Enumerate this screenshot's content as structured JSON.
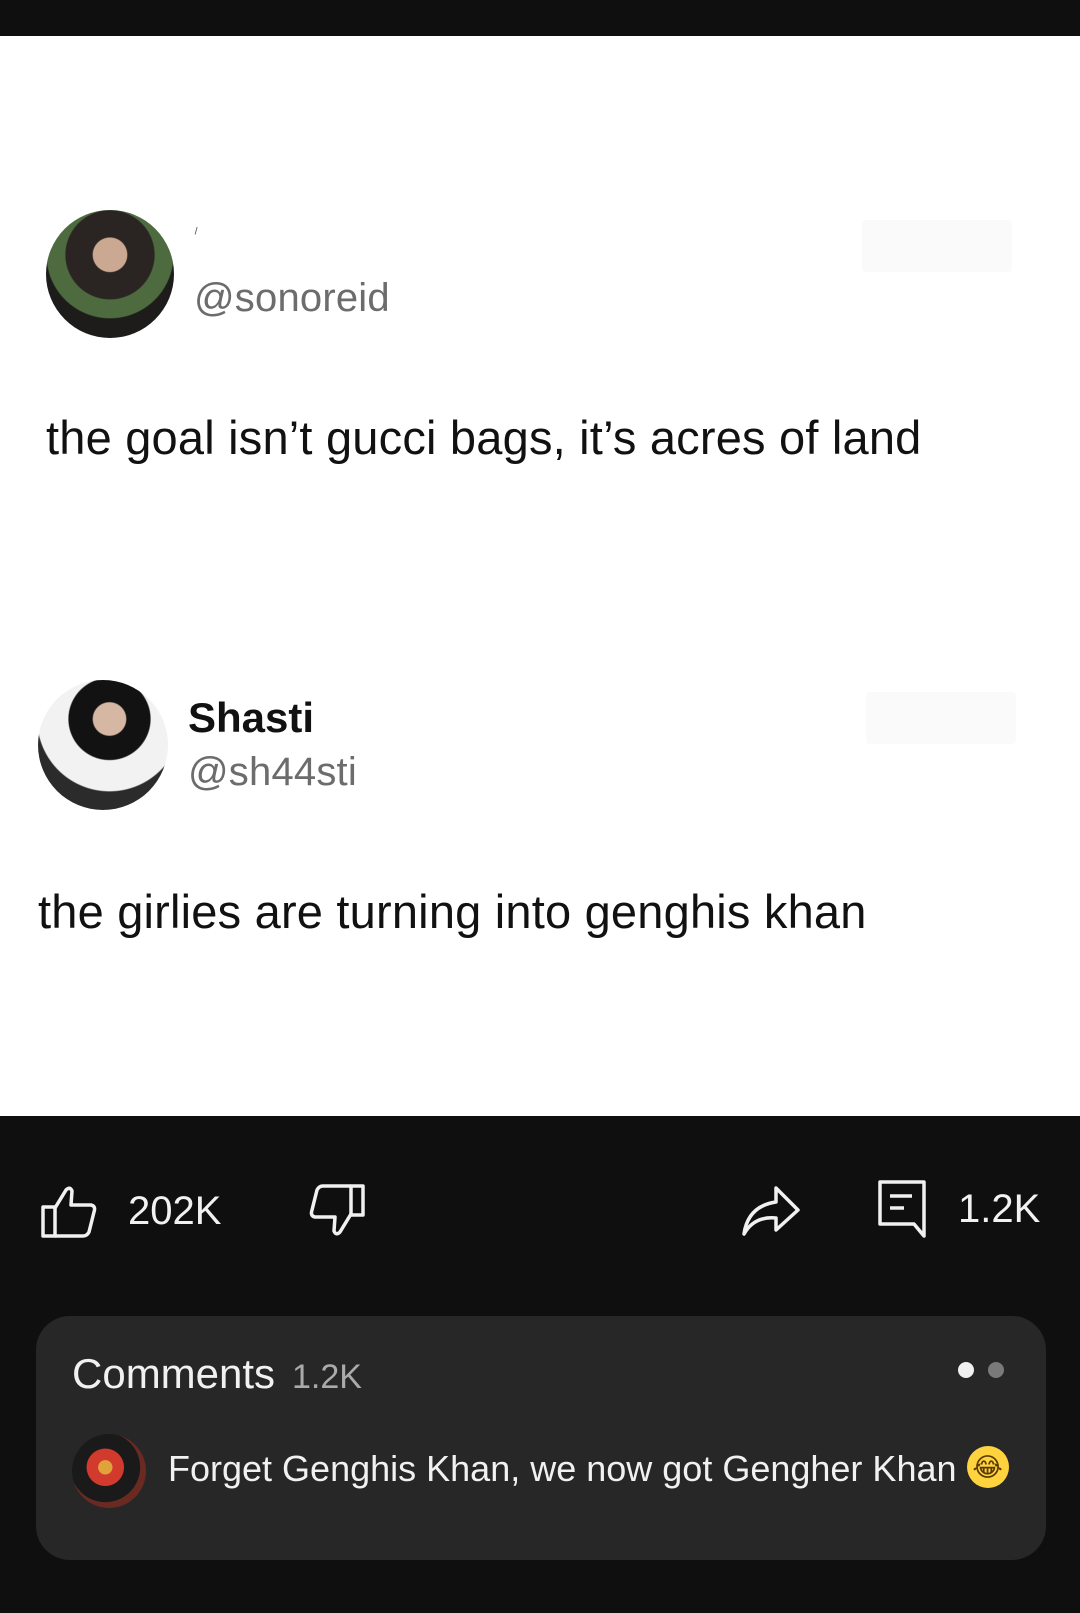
{
  "post": {
    "tweet1": {
      "handle": "@sonoreid",
      "text": "the goal isn’t gucci bags, it’s acres of land"
    },
    "tweet2": {
      "name": "Shasti",
      "handle": "@sh44sti",
      "text": "the girlies are turning into genghis khan"
    }
  },
  "actions": {
    "like_count": "202K",
    "comment_count": "1.2K"
  },
  "comments": {
    "title": "Comments",
    "count": "1.2K",
    "top_comment": {
      "text": "Forget Genghis Khan, we now got Gengher Khan",
      "emoji": "😂"
    }
  },
  "colors": {
    "background": "#0f0f0f",
    "card": "#272727",
    "text_light": "#f1f1f1",
    "text_muted": "#aaaaaa"
  }
}
